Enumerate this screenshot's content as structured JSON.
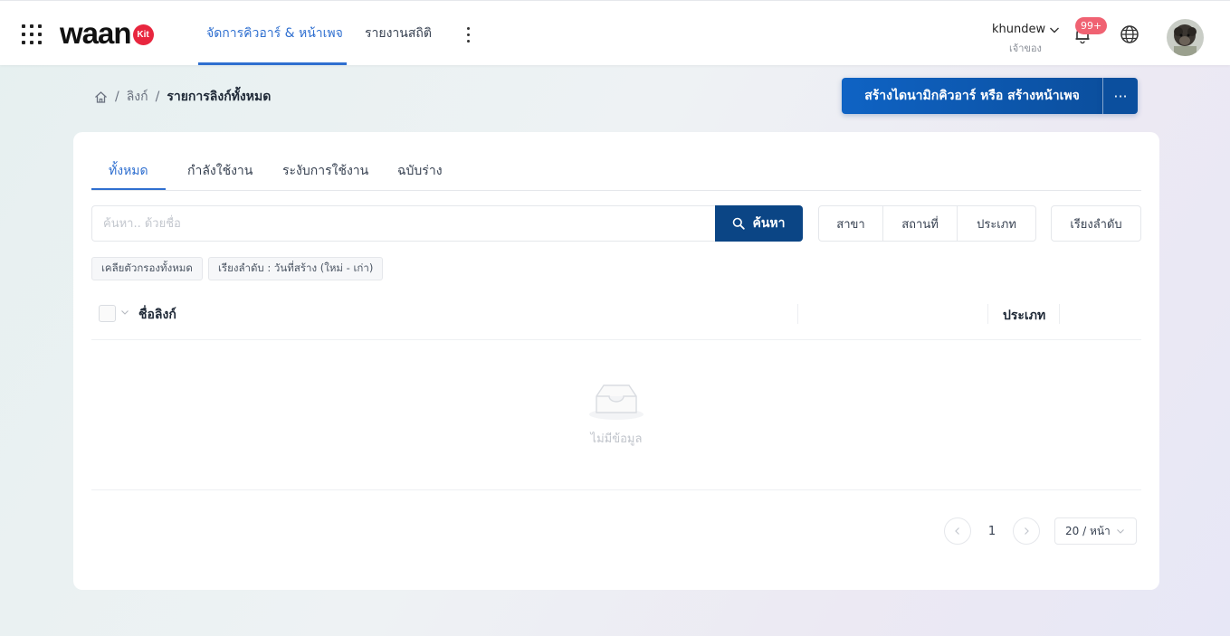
{
  "header": {
    "logo_text": "waan",
    "logo_badge": "Kit",
    "nav": [
      {
        "label": "จัดการคิวอาร์ & หน้าเพจ",
        "active": true
      },
      {
        "label": "รายงานสถิติ",
        "active": false
      }
    ],
    "user": {
      "name": "khundew",
      "role": "เจ้าของ"
    },
    "notification_count": "99+",
    "icons": [
      "apps-grid-icon",
      "more-vertical-icon",
      "chevron-down-icon",
      "bell-icon",
      "globe-icon"
    ]
  },
  "breadcrumb": {
    "items": [
      "ลิงก์",
      "รายการลิงก์ทั้งหมด"
    ]
  },
  "actions": {
    "create_label": "สร้างไดนามิกคิวอาร์ หรือ สร้างหน้าเพจ",
    "more_label": "···"
  },
  "tabs": [
    {
      "label": "ทั้งหมด",
      "active": true
    },
    {
      "label": "กำลังใช้งาน",
      "active": false
    },
    {
      "label": "ระงับการใช้งาน",
      "active": false
    },
    {
      "label": "ฉบับร่าง",
      "active": false
    }
  ],
  "search": {
    "placeholder": "ค้นหา.. ด้วยชื่อ",
    "value": "",
    "button_label": "ค้นหา"
  },
  "filters": [
    "สาขา",
    "สถานที่",
    "ประเภท"
  ],
  "sort_label": "เรียงลำดับ",
  "chips": {
    "clear": "เคลียตัวกรองทั้งหมด",
    "sort": "เรียงลำดับ : วันที่สร้าง (ใหม่ - เก่า)"
  },
  "table": {
    "columns": [
      "ชื่อลิงก์",
      "ประเภท"
    ],
    "rows": [],
    "empty_text": "ไม่มีข้อมูล"
  },
  "pagination": {
    "current_page": "1",
    "page_size": "20 / หน้า"
  },
  "colors": {
    "accent": "#2f6fd0",
    "primary_button": "#0b4f9e",
    "search_button": "#0b4585",
    "badge": "#f06272",
    "logo_badge": "#e8263e"
  }
}
